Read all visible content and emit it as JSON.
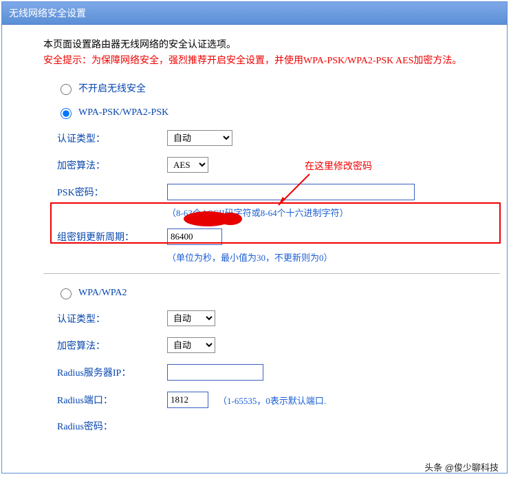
{
  "title": "无线网络安全设置",
  "intro": {
    "line1": "本页面设置路由器无线网络的安全认证选项。",
    "line2": "安全提示：为保障网络安全，强烈推荐开启安全设置，并使用WPA-PSK/WPA2-PSK AES加密方法。"
  },
  "annotation": "在这里修改密码",
  "options": {
    "disable": {
      "label": "不开启无线安全",
      "checked": false
    },
    "wpa_psk": {
      "label": "WPA-PSK/WPA2-PSK",
      "checked": true,
      "auth_label": "认证类型：",
      "auth_value": "自动",
      "enc_label": "加密算法：",
      "enc_value": "AES",
      "psk_label": "PSK密码：",
      "psk_value": "",
      "psk_hint": "（8-63个ASCII码字符或8-64个十六进制字符）",
      "gkey_label": "组密钥更新周期：",
      "gkey_value": "86400",
      "gkey_hint": "（单位为秒，最小值为30，不更新则为0）"
    },
    "wpa": {
      "label": "WPA/WPA2",
      "checked": false,
      "auth_label": "认证类型：",
      "auth_value": "自动",
      "enc_label": "加密算法：",
      "enc_value": "自动",
      "radius_ip_label": "Radius服务器IP：",
      "radius_ip_value": "",
      "radius_port_label": "Radius端口：",
      "radius_port_value": "1812",
      "radius_port_hint": "（1-65535，0表示默认端口.",
      "radius_pw_label": "Radius密码："
    }
  },
  "watermark": "头条 @俊少聊科技"
}
